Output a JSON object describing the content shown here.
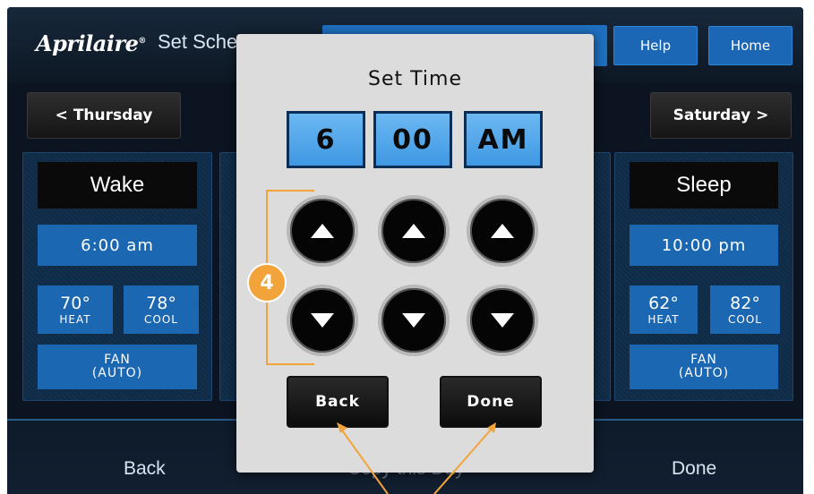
{
  "header": {
    "brand": "Aprilaire",
    "brand_mark": "®",
    "title": "Set Schedule",
    "help_label": "Help",
    "home_label": "Home"
  },
  "days": {
    "prev_label": "< Thursday",
    "next_label": "Saturday >"
  },
  "cards": {
    "left": {
      "label": "Wake",
      "time": "6:00 am",
      "heat": "70°",
      "heat_label": "HEAT",
      "cool": "78°",
      "cool_label": "COOL",
      "fan": "FAN",
      "fan_mode": "(AUTO)"
    },
    "right": {
      "label": "Sleep",
      "time": "10:00 pm",
      "heat": "62°",
      "heat_label": "HEAT",
      "cool": "82°",
      "cool_label": "COOL",
      "fan": "FAN",
      "fan_mode": "(AUTO)"
    }
  },
  "bottom": {
    "back_label": "Back",
    "copy_label": "Copy this Day",
    "done_label": "Done"
  },
  "modal": {
    "title": "Set Time",
    "hour": "6",
    "minute": "00",
    "ampm": "AM",
    "back_label": "Back",
    "done_label": "Done"
  },
  "annotation": {
    "badge": "4",
    "color": "#f2a33a"
  },
  "colors": {
    "accent_blue": "#1c67b2",
    "time_box": "#4fa6ea",
    "screen_bg": "#0b1420",
    "modal_bg": "#dcdcdc"
  }
}
